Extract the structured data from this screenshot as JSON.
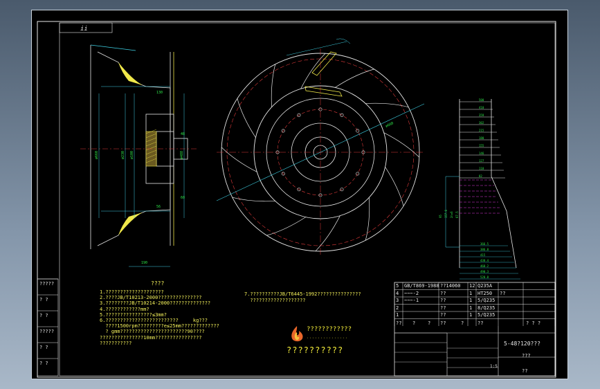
{
  "drawing": {
    "corner_tag": "ii",
    "dims": {
      "d1": "ø660",
      "d2": "ø488",
      "d3": "ø230",
      "d4": "ø100",
      "r1": "R25",
      "w1": "130",
      "w2": "56",
      "w3": "60",
      "w4": "48",
      "w5": "190",
      "dia_big": "ø660"
    },
    "table_ticks": [
      "500",
      "410",
      "359",
      "302",
      "215",
      "180",
      "155",
      "146",
      "127",
      "118",
      "82"
    ],
    "side_dims": [
      "95",
      "157.6",
      "2n=6",
      "67.5"
    ],
    "side_bottom": [
      "366.5",
      "386.8",
      "415",
      "438.4",
      "468.2",
      "490.3",
      "528.8"
    ]
  },
  "notes": {
    "title": "????",
    "left_lines": [
      "1.????????????????????",
      "2.????JB/T10213-2000???????????????",
      "3.????????JB/T10214-2000??????????????",
      "4.????????????mm?",
      "5.????????????????≤3mm?",
      "6.?????????????????????????     kg???",
      "  ????1500rpm?????????e≤25mm?????????????",
      "  ? gmm???????????????????????90????",
      "???????????????10mm????????????????",
      "???????????"
    ],
    "right_lines": [
      "7.??????????JB/T6445-1992???????????????",
      "  ???????????????????"
    ]
  },
  "logo": {
    "name": "????????????",
    "tagline": "···············",
    "bottom_text": "??????????"
  },
  "left_strip": {
    "labels": [
      "?????",
      "?  ?",
      "?  ?",
      "?????",
      "?  ?",
      "?  ?"
    ]
  },
  "title_block": {
    "parts": [
      [
        "5",
        "GB/T869-1988",
        "??14060",
        "12",
        "Q235A",
        ""
      ],
      [
        "4",
        "~~~-2",
        "??",
        "1",
        "HT250",
        "??"
      ],
      [
        "3",
        "~~~-1",
        "??",
        "1",
        "5/Q235",
        ""
      ],
      [
        "2",
        "",
        "??",
        "1",
        "8/Q235",
        ""
      ],
      [
        "1",
        "",
        "??",
        "1",
        "5/Q235",
        ""
      ]
    ],
    "header": [
      "??",
      "?",
      "?",
      "??",
      "?",
      "??",
      "?  ?  ?"
    ],
    "drawing_name": "5-48?120???",
    "material_cell": "???",
    "scale": "1:5",
    "company": "??"
  }
}
